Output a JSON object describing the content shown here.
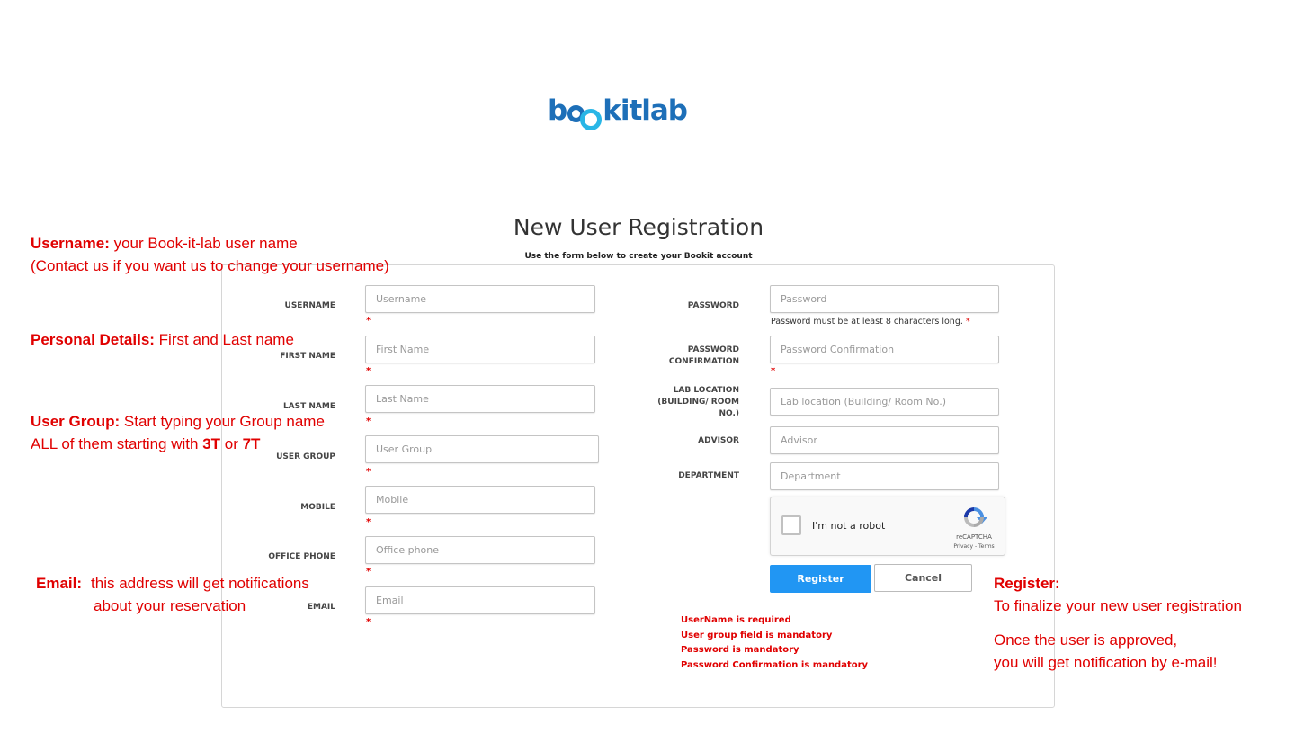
{
  "logo": {
    "text_b": "b",
    "text_kit": "kit",
    "text_lab": "lab",
    "alt": "bookitlab"
  },
  "header": {
    "title": "New User Registration",
    "subtitle": "Use the form below to create your Bookit account"
  },
  "form": {
    "left_fields": [
      {
        "label": "USERNAME",
        "placeholder": "Username"
      },
      {
        "label": "FIRST NAME",
        "placeholder": "First Name"
      },
      {
        "label": "LAST NAME",
        "placeholder": "Last Name"
      },
      {
        "label": "USER GROUP",
        "placeholder": "User Group"
      },
      {
        "label": "MOBILE",
        "placeholder": "Mobile"
      },
      {
        "label": "OFFICE PHONE",
        "placeholder": "Office phone"
      },
      {
        "label": "EMAIL",
        "placeholder": "Email"
      }
    ],
    "required_marker": "*",
    "right_fields": {
      "password": {
        "label": "PASSWORD",
        "placeholder": "Password",
        "hint": "Password must be at least 8 characters long.",
        "hint_marker": "*"
      },
      "password_confirmation": {
        "label_line1": "PASSWORD",
        "label_line2": "CONFIRMATION",
        "placeholder": "Password Confirmation"
      },
      "lab_location": {
        "label_line1": "LAB LOCATION",
        "label_line2": "(BUILDING/ ROOM",
        "label_line3": "NO.)",
        "placeholder": "Lab location (Building/ Room No.)"
      },
      "advisor": {
        "label": "ADVISOR",
        "placeholder": "Advisor"
      },
      "department": {
        "label": "DEPARTMENT",
        "placeholder": "Department"
      }
    },
    "captcha": {
      "text": "I'm not a robot",
      "brand": "reCAPTCHA",
      "terms": "Privacy - Terms"
    },
    "buttons": {
      "register": "Register",
      "cancel": "Cancel"
    },
    "errors": [
      "UserName is required",
      "User group field is mandatory",
      "Password is mandatory",
      "Password Confirmation is mandatory"
    ]
  },
  "annotations": {
    "username": {
      "bold": "Username:",
      "text": " your Book-it-lab user name",
      "line2": "(Contact us if you want us to change your username)"
    },
    "personal": {
      "bold": "Personal Details:",
      "text": " First and Last name"
    },
    "user_group": {
      "bold": "User Group:",
      "text": " Start typing your Group name",
      "line2_pre": "ALL of them starting with ",
      "line2_b1": "3T",
      "line2_mid": " or ",
      "line2_b2": "7T"
    },
    "email": {
      "bold": "Email:",
      "text": "this address will get notifications",
      "line2": "about your reservation"
    },
    "register": {
      "bold": "Register:",
      "line2": "To finalize your new user registration",
      "line3": "Once the user is approved,",
      "line4": "you will get notification by e-mail!"
    }
  },
  "colors": {
    "annotation": "#e00000",
    "primary": "#2196f3",
    "logo_dark": "#1d6fb8",
    "logo_light": "#29b6e6"
  }
}
